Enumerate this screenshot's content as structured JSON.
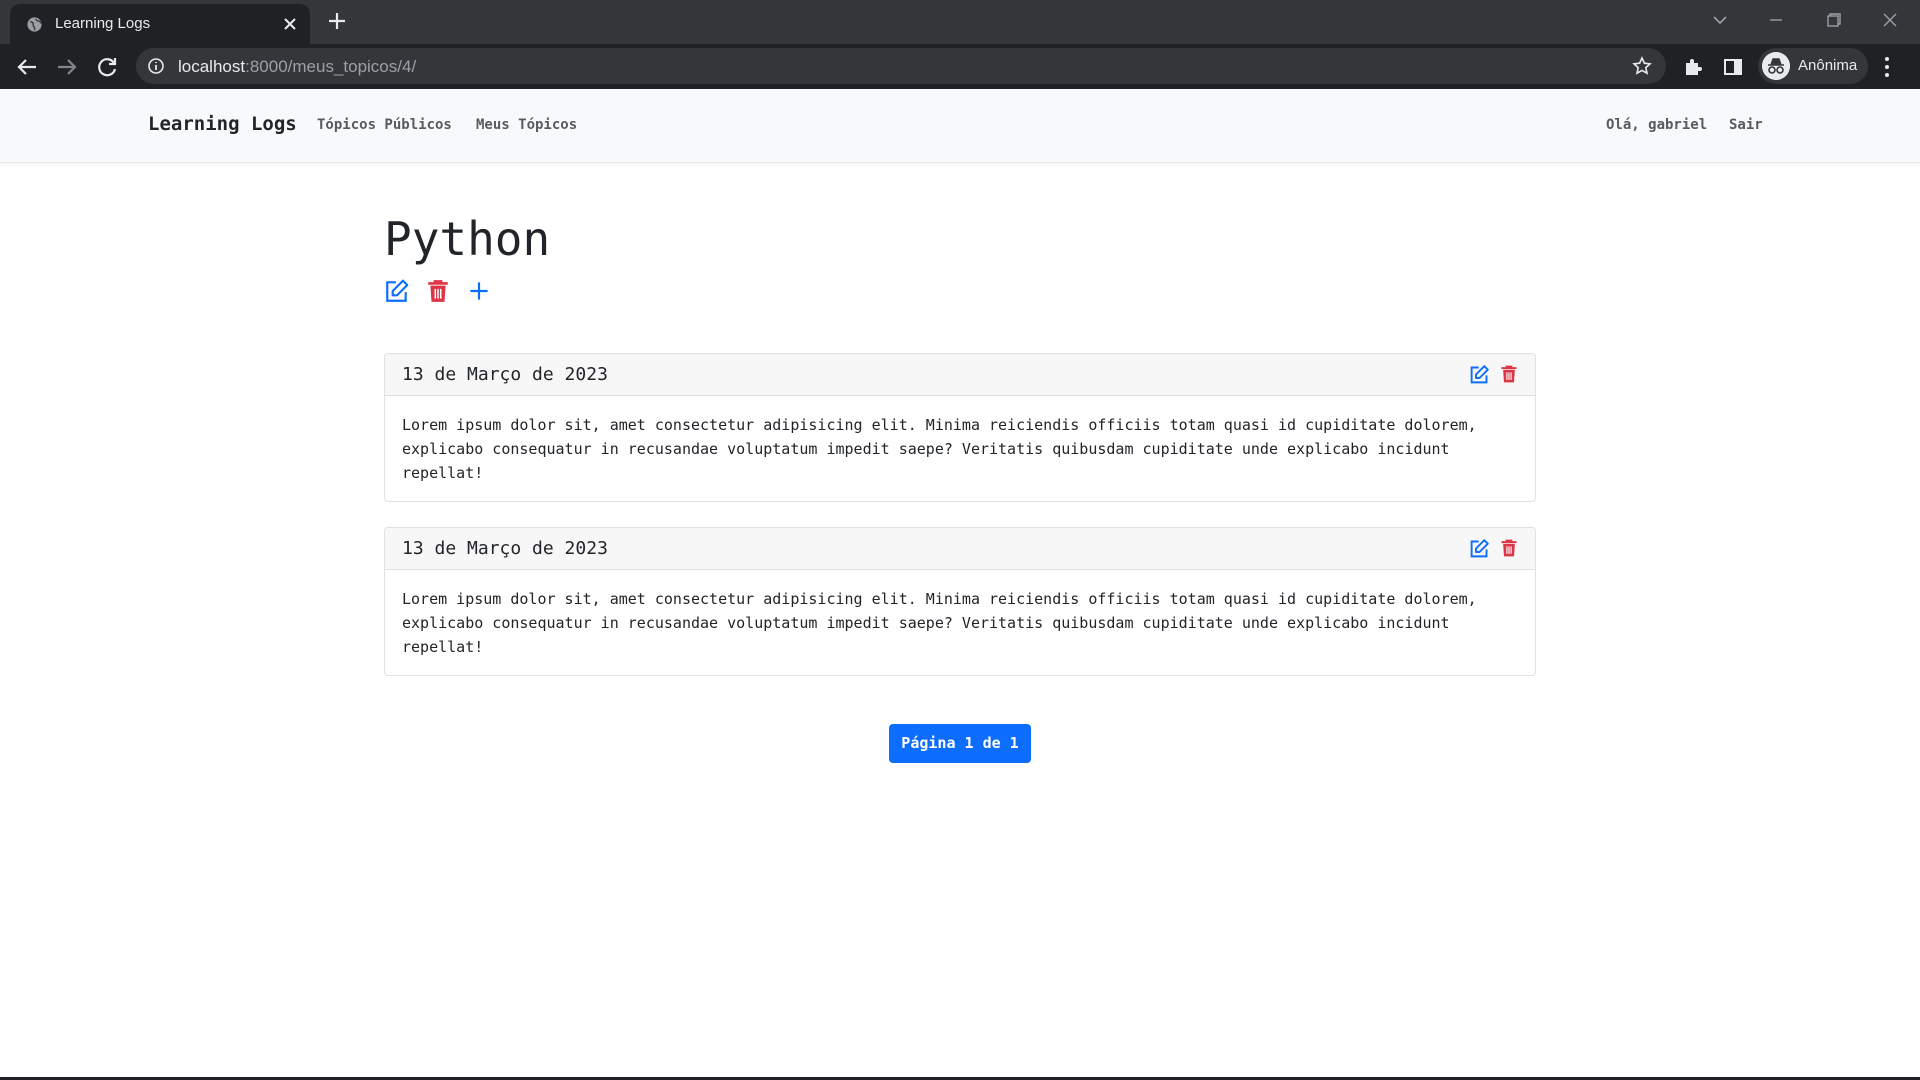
{
  "browser": {
    "tab_title": "Learning Logs",
    "url_host": "localhost",
    "url_path": ":8000/meus_topicos/4/",
    "profile_label": "Anônima"
  },
  "navbar": {
    "brand": "Learning Logs",
    "links": [
      "Tópicos Públicos",
      "Meus Tópicos"
    ],
    "greeting": "Olá, gabriel",
    "logout": "Sair"
  },
  "topic": {
    "title": "Python"
  },
  "entries": [
    {
      "date": "13 de Março de 2023",
      "text": "Lorem ipsum dolor sit, amet consectetur adipisicing elit. Minima reiciendis officiis totam quasi id cupiditate dolorem, explicabo consequatur in recusandae voluptatum impedit saepe? Veritatis quibusdam cupiditate unde explicabo incidunt repellat!"
    },
    {
      "date": "13 de Março de 2023",
      "text": "Lorem ipsum dolor sit, amet consectetur adipisicing elit. Minima reiciendis officiis totam quasi id cupiditate dolorem, explicabo consequatur in recusandae voluptatum impedit saepe? Veritatis quibusdam cupiditate unde explicabo incidunt repellat!"
    }
  ],
  "pagination": {
    "label": "Página 1 de 1"
  },
  "colors": {
    "primary": "#0d6efd",
    "danger": "#dc3545",
    "navbar_bg": "#f8f9fa",
    "chrome_dark": "#202124"
  },
  "icons": {
    "topic_actions": [
      "edit-icon",
      "trash-icon",
      "plus-icon"
    ],
    "entry_actions": [
      "edit-icon",
      "trash-icon"
    ]
  }
}
